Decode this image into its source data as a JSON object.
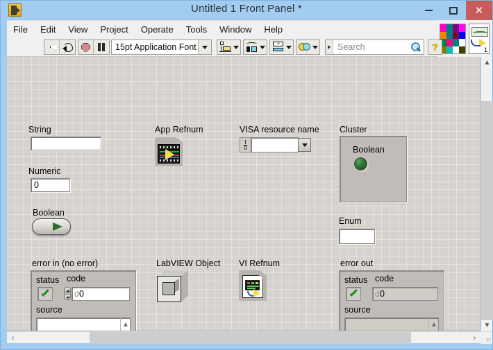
{
  "window": {
    "title": "Untitled 1 Front Panel *",
    "app_icon": "labview-vi-icon",
    "minimize_label": "–",
    "maximize_label": "□",
    "close_label": "✕"
  },
  "menubar": {
    "items": [
      {
        "label": "File"
      },
      {
        "label": "Edit"
      },
      {
        "label": "View"
      },
      {
        "label": "Project"
      },
      {
        "label": "Operate"
      },
      {
        "label": "Tools"
      },
      {
        "label": "Window"
      },
      {
        "label": "Help"
      }
    ]
  },
  "toolbar": {
    "run_tooltip": "Run",
    "run_continuous_tooltip": "Run Continuously",
    "abort_tooltip": "Abort Execution",
    "pause_tooltip": "Pause",
    "font_label": "15pt Application Font",
    "align_tooltip": "Align Objects",
    "distribute_tooltip": "Distribute Objects",
    "resize_tooltip": "Resize Objects",
    "reorder_tooltip": "Reorder",
    "search_placeholder": "Search",
    "search_value": "",
    "help_label": "?"
  },
  "palette": {
    "swatch_colors": [
      "#ff00c8",
      "#008080",
      "#800080",
      "#ff00ff",
      "#ff8000",
      "#008080",
      "#800040",
      "#0000ff",
      "#008040",
      "#ff0080",
      "#008080",
      "#ffffff",
      "#808000",
      "#00c0c0",
      "#ffffff",
      "#404000"
    ],
    "vi_icon_number": "1"
  },
  "panel": {
    "controls": [
      {
        "name": "String",
        "type": "string-control",
        "value": ""
      },
      {
        "name": "Numeric",
        "type": "numeric-control",
        "value": "0"
      },
      {
        "name": "Boolean",
        "type": "boolean-switch",
        "value": "off"
      },
      {
        "name": "App Refnum",
        "type": "refnum-control",
        "value": ""
      },
      {
        "name": "VISA resource name",
        "type": "visa-combo",
        "value": ""
      },
      {
        "name": "Cluster",
        "type": "cluster",
        "value": ""
      },
      {
        "name": "Enum",
        "type": "enum-control",
        "value": ""
      },
      {
        "name": "LabVIEW Object",
        "type": "object-control",
        "value": ""
      },
      {
        "name": "VI Refnum",
        "type": "refnum-control",
        "value": ""
      }
    ],
    "string": {
      "label": "String",
      "value": ""
    },
    "numeric": {
      "label": "Numeric",
      "value": "0"
    },
    "boolean": {
      "label": "Boolean",
      "state": "off"
    },
    "app_refnum": {
      "label": "App Refnum"
    },
    "visa": {
      "label": "VISA resource name",
      "io_top": "I",
      "io_bottom": "0",
      "value": ""
    },
    "cluster": {
      "label": "Cluster",
      "boolean_label": "Boolean",
      "led_color": "#2f7a2f",
      "led_state": "off"
    },
    "enum": {
      "label": "Enum",
      "value": ""
    },
    "labview_object": {
      "label": "LabVIEW Object"
    },
    "vi_refnum": {
      "label": "VI Refnum"
    },
    "error_in": {
      "label": "error in (no error)",
      "status_label": "status",
      "status_value": "no error",
      "code_label": "code",
      "code_prefix": "d",
      "code_value": "0",
      "source_label": "source",
      "source_value": ""
    },
    "error_out": {
      "label": "error out",
      "status_label": "status",
      "status_value": "no error",
      "code_label": "code",
      "code_prefix": "d",
      "code_value": "0",
      "source_label": "source",
      "source_value": ""
    }
  },
  "scrollbars": {
    "v_up": "▲",
    "v_down": "▼",
    "h_left": "‹",
    "h_right": "›"
  }
}
